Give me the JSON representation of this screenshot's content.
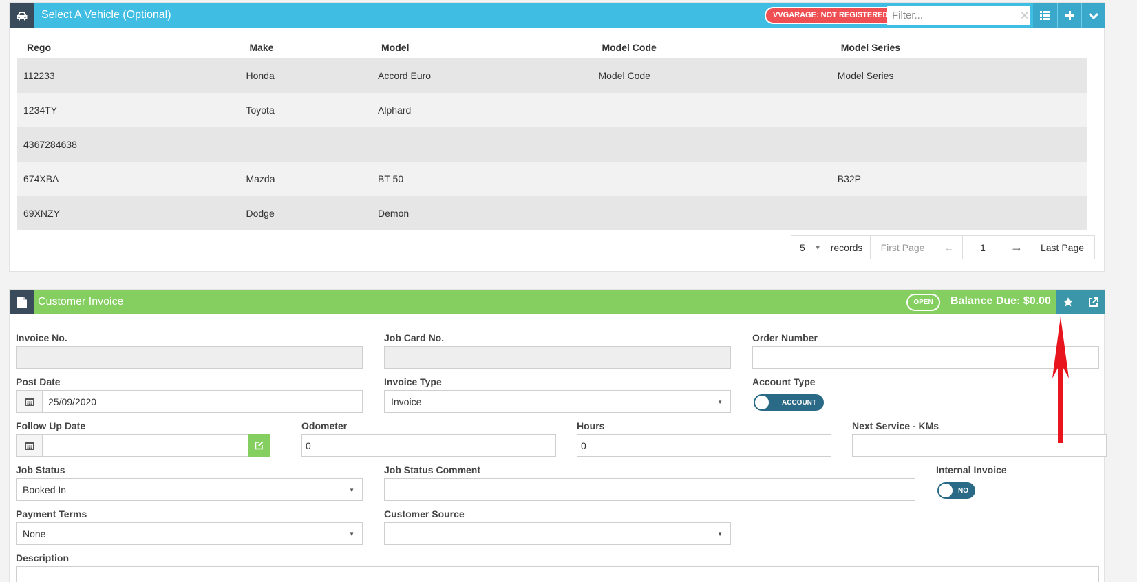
{
  "vehicle_panel": {
    "title": "Select A Vehicle (Optional)",
    "badge": "VVGARAGE: NOT REGISTERED",
    "filter_placeholder": "Filter...",
    "columns": [
      "Rego",
      "Make",
      "Model",
      "Model Code",
      "Model Series"
    ],
    "rows": [
      [
        "112233",
        "Honda",
        "Accord Euro",
        "Model Code",
        "Model Series"
      ],
      [
        "1234TY",
        "Toyota",
        "Alphard",
        "",
        ""
      ],
      [
        "4367284638",
        "",
        "",
        "",
        ""
      ],
      [
        "674XBA",
        "Mazda",
        "BT 50",
        "",
        "B32P"
      ],
      [
        "69XNZY",
        "Dodge",
        "Demon",
        "",
        ""
      ]
    ],
    "pager": {
      "page_size": "5",
      "records_label": "records",
      "first": "First Page",
      "prev": "←",
      "current": "1",
      "next": "→",
      "last": "Last Page"
    }
  },
  "invoice_panel": {
    "title": "Customer Invoice",
    "status_badge": "OPEN",
    "balance": "Balance Due: $0.00",
    "fields": {
      "invoice_no": {
        "label": "Invoice No.",
        "value": ""
      },
      "job_card_no": {
        "label": "Job Card No.",
        "value": ""
      },
      "order_number": {
        "label": "Order Number",
        "value": ""
      },
      "post_date": {
        "label": "Post Date",
        "value": "25/09/2020"
      },
      "invoice_type": {
        "label": "Invoice Type",
        "value": "Invoice"
      },
      "account_type": {
        "label": "Account Type",
        "value": "ACCOUNT"
      },
      "follow_up_date": {
        "label": "Follow Up Date",
        "value": ""
      },
      "odometer": {
        "label": "Odometer",
        "value": "0"
      },
      "hours": {
        "label": "Hours",
        "value": "0"
      },
      "next_service": {
        "label": "Next Service - KMs",
        "value": ""
      },
      "job_status": {
        "label": "Job Status",
        "value": "Booked In"
      },
      "job_status_comment": {
        "label": "Job Status Comment",
        "value": ""
      },
      "internal_invoice": {
        "label": "Internal Invoice",
        "value": "NO"
      },
      "payment_terms": {
        "label": "Payment Terms",
        "value": "None"
      },
      "customer_source": {
        "label": "Customer Source",
        "value": ""
      },
      "description": {
        "label": "Description",
        "value": ""
      }
    }
  },
  "colors": {
    "vehicle_header": "#3fbde3",
    "invoice_header": "#84cf60",
    "badge_red": "#ef4f52",
    "dark_icon_box": "#3a4b5c",
    "toggle": "#2a6a86",
    "annotation_arrow": "#e8141e"
  },
  "icons": [
    "car-icon",
    "list-icon",
    "plus-icon",
    "chevron-down-icon",
    "document-icon",
    "star-icon",
    "external-link-icon",
    "calendar-icon",
    "edit-icon"
  ]
}
